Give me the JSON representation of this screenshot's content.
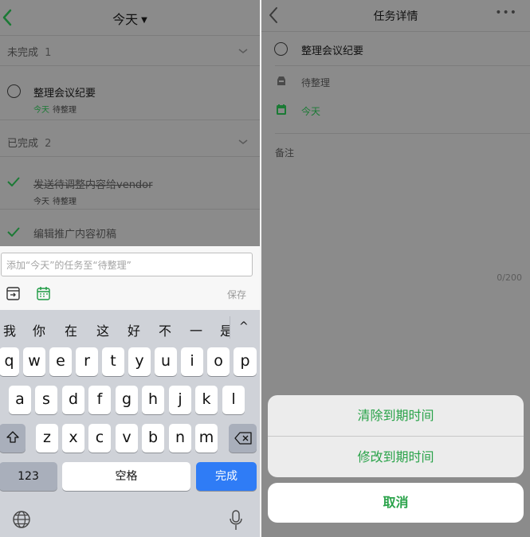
{
  "left": {
    "nav": {
      "title": "今天",
      "caret": "▼"
    },
    "sections": {
      "incomplete": {
        "label": "未完成",
        "count": "1"
      },
      "complete": {
        "label": "已完成",
        "count": "2"
      }
    },
    "tasks": {
      "open": {
        "title": "整理会议纪要",
        "date": "今天",
        "list": "待整理"
      },
      "done1": {
        "title": "发送待调整内容给vendor",
        "date": "今天",
        "list": "待整理"
      },
      "done2": {
        "title": "编辑推广内容初稿"
      }
    },
    "input": {
      "placeholder": "添加“今天”的任务至“待整理”",
      "save_label": "保存"
    },
    "keyboard": {
      "candidates": [
        "我",
        "你",
        "在",
        "这",
        "好",
        "不",
        "一",
        "是"
      ],
      "expand": "^",
      "row1": [
        "q",
        "w",
        "e",
        "r",
        "t",
        "y",
        "u",
        "i",
        "o",
        "p"
      ],
      "row2": [
        "a",
        "s",
        "d",
        "f",
        "g",
        "h",
        "j",
        "k",
        "l"
      ],
      "row3": [
        "z",
        "x",
        "c",
        "v",
        "b",
        "n",
        "m"
      ],
      "numbers": "123",
      "space": "空格",
      "done": "完成"
    }
  },
  "right": {
    "nav": {
      "title": "任务详情",
      "more": "•••"
    },
    "task": {
      "title": "整理会议纪要"
    },
    "list": "待整理",
    "date": "今天",
    "note_label": "备注",
    "note_count": "0/200",
    "sheet": {
      "clear_due": "清除到期时间",
      "change_due": "修改到期时间",
      "cancel": "取消"
    }
  },
  "colors": {
    "accent_green": "#2aa34a",
    "key_blue": "#2f7cf6"
  },
  "icons": [
    "back-chevron-icon",
    "chevron-down-icon",
    "checkmark-icon",
    "inbox-icon",
    "calendar-icon",
    "shift-icon",
    "backspace-icon",
    "globe-icon",
    "microphone-icon",
    "more-icon"
  ]
}
